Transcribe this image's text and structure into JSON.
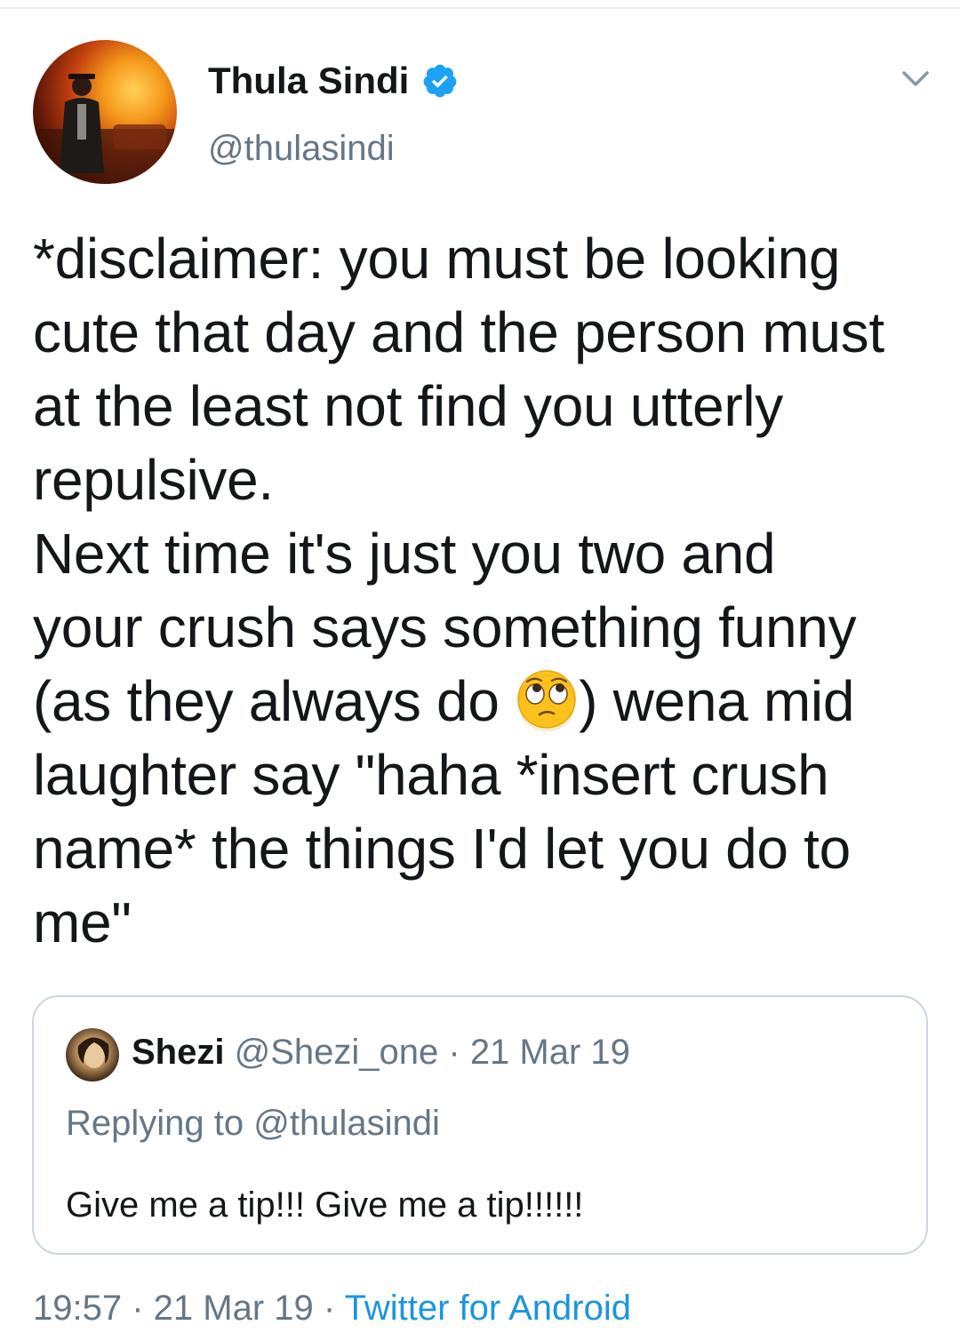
{
  "author": {
    "display_name": "Thula Sindi",
    "handle": "@thulasindi",
    "verified": true
  },
  "tweet": {
    "text_before_emoji": "*disclaimer: you must be looking\ncute that day and the person must\nat the least not find you utterly\nrepulsive.\nNext time it's just you two and\nyour crush says something funny\n(as they always do ",
    "emoji": "face-with-rolling-eyes",
    "text_after_emoji": ") wena mid\nlaughter say \"haha *insert crush\nname* the things I'd let you do to\nme\""
  },
  "quoted_tweet": {
    "display_name": "Shezi",
    "handle": "@Shezi_one",
    "separator": " · ",
    "date": "21 Mar 19",
    "replying_to": "Replying to @thulasindi",
    "text": "Give me a tip!!! Give me a tip!!!!!!"
  },
  "meta": {
    "time": "19:57",
    "separator": " · ",
    "date": "21 Mar 19",
    "source": "Twitter for Android"
  },
  "colors": {
    "text_primary": "#14171a",
    "text_secondary": "#657786",
    "link": "#1b95e0",
    "verified_badge": "#1da1f2",
    "border": "#ccd6dd"
  },
  "icons": {
    "menu": "chevron-down-icon",
    "verified": "verified-badge-icon"
  }
}
